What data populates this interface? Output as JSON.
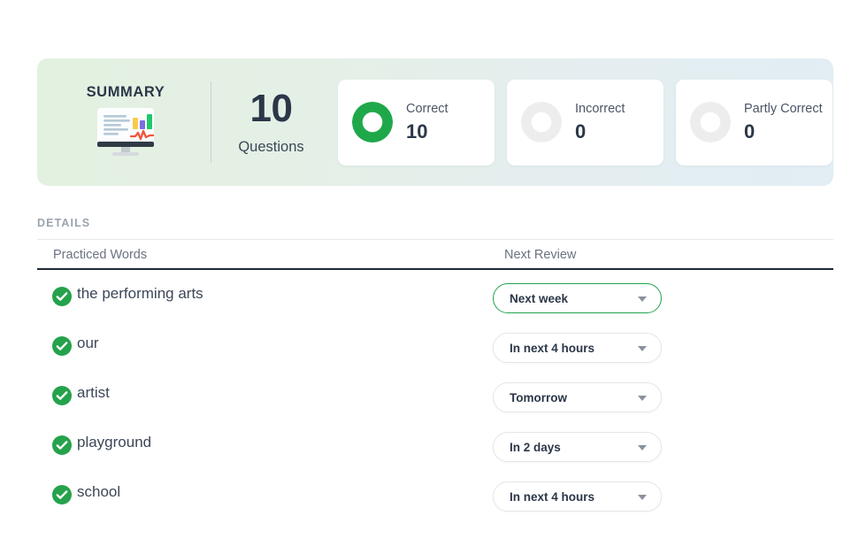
{
  "summary": {
    "title": "SUMMARY",
    "icon": "monitor-report-icon",
    "questions_count": "10",
    "questions_label": "Questions",
    "stats": [
      {
        "label": "Correct",
        "value": "10",
        "ring": "green",
        "ring_color": "#1fa84a"
      },
      {
        "label": "Incorrect",
        "value": "0",
        "ring": "grey",
        "ring_color": "#ededee"
      },
      {
        "label": "Partly Correct",
        "value": "0",
        "ring": "grey",
        "ring_color": "#ededee"
      }
    ]
  },
  "details": {
    "section_label": "DETAILS",
    "columns": {
      "words": "Practiced Words",
      "review": "Next Review"
    },
    "rows": [
      {
        "status": "correct",
        "word": "the performing arts",
        "review": "Next week",
        "active": true
      },
      {
        "status": "correct",
        "word": "our",
        "review": "In next 4 hours",
        "active": false
      },
      {
        "status": "correct",
        "word": "artist",
        "review": "Tomorrow",
        "active": false
      },
      {
        "status": "correct",
        "word": "playground",
        "review": "In 2 days",
        "active": false
      },
      {
        "status": "correct",
        "word": "school",
        "review": "In next 4 hours",
        "active": false
      }
    ]
  },
  "theme": {
    "accent_green": "#22a34b",
    "text_dark": "#2b3648",
    "muted": "#6b7280"
  }
}
